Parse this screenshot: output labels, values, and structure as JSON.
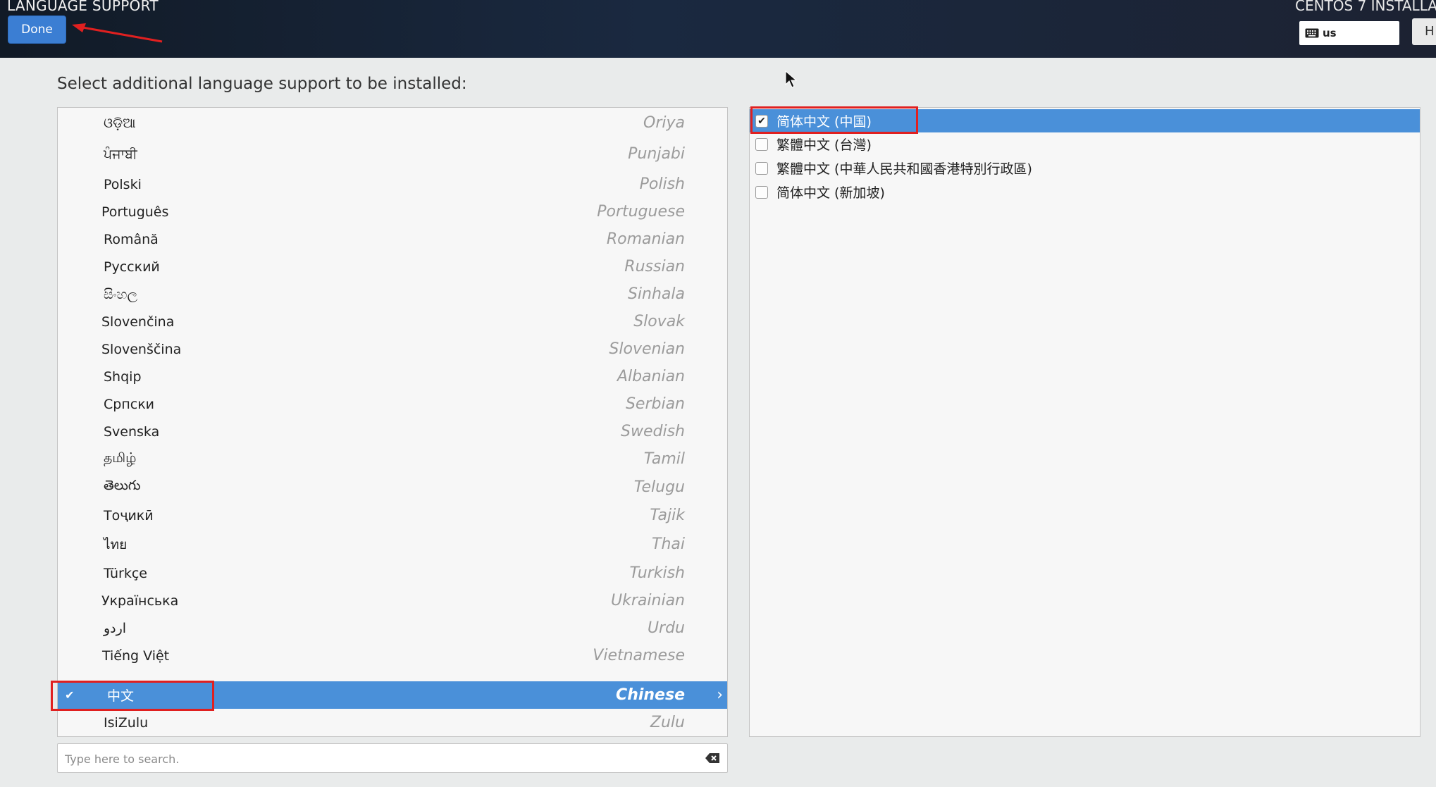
{
  "header": {
    "title": "LANGUAGE SUPPORT",
    "done_label": "Done",
    "product": "CENTOS 7 INSTALLA",
    "keyboard_layout": "us",
    "help_label": "H"
  },
  "prompt": "Select additional language support to be installed:",
  "languages": [
    {
      "native": "ଓଡ଼ିଆ",
      "english": "Oriya"
    },
    {
      "native": "ਪੰਜਾਬੀ",
      "english": "Punjabi"
    },
    {
      "native": "Polski",
      "english": "Polish"
    },
    {
      "native": "Português",
      "english": "Portuguese"
    },
    {
      "native": "Română",
      "english": "Romanian"
    },
    {
      "native": "Русский",
      "english": "Russian"
    },
    {
      "native": "සිංහල",
      "english": "Sinhala"
    },
    {
      "native": "Slovenčina",
      "english": "Slovak"
    },
    {
      "native": "Slovenščina",
      "english": "Slovenian"
    },
    {
      "native": "Shqip",
      "english": "Albanian"
    },
    {
      "native": "Српски",
      "english": "Serbian"
    },
    {
      "native": "Svenska",
      "english": "Swedish"
    },
    {
      "native": "தமிழ்",
      "english": "Tamil"
    },
    {
      "native": "తెలుగు",
      "english": "Telugu"
    },
    {
      "native": "Тоҷикӣ",
      "english": "Tajik"
    },
    {
      "native": "ไทย",
      "english": "Thai"
    },
    {
      "native": "Türkçe",
      "english": "Turkish"
    },
    {
      "native": "Українська",
      "english": "Ukrainian"
    },
    {
      "native": "اردو",
      "english": "Urdu"
    },
    {
      "native": "Tiếng Việt",
      "english": "Vietnamese"
    },
    {
      "native": "中文",
      "english": "Chinese",
      "selected": true
    },
    {
      "native": "IsiZulu",
      "english": "Zulu"
    }
  ],
  "locales": [
    {
      "label": "简体中文 (中国)",
      "checked": true,
      "selected": true
    },
    {
      "label": "繁體中文 (台灣)",
      "checked": false
    },
    {
      "label": "繁體中文 (中華人民共和國香港特別行政區)",
      "checked": false
    },
    {
      "label": "简体中文 (新加坡)",
      "checked": false
    }
  ],
  "search": {
    "placeholder": "Type here to search."
  },
  "colors": {
    "selection": "#4a90d9",
    "annotation": "#e02020",
    "done_button": "#3b7ed3"
  }
}
